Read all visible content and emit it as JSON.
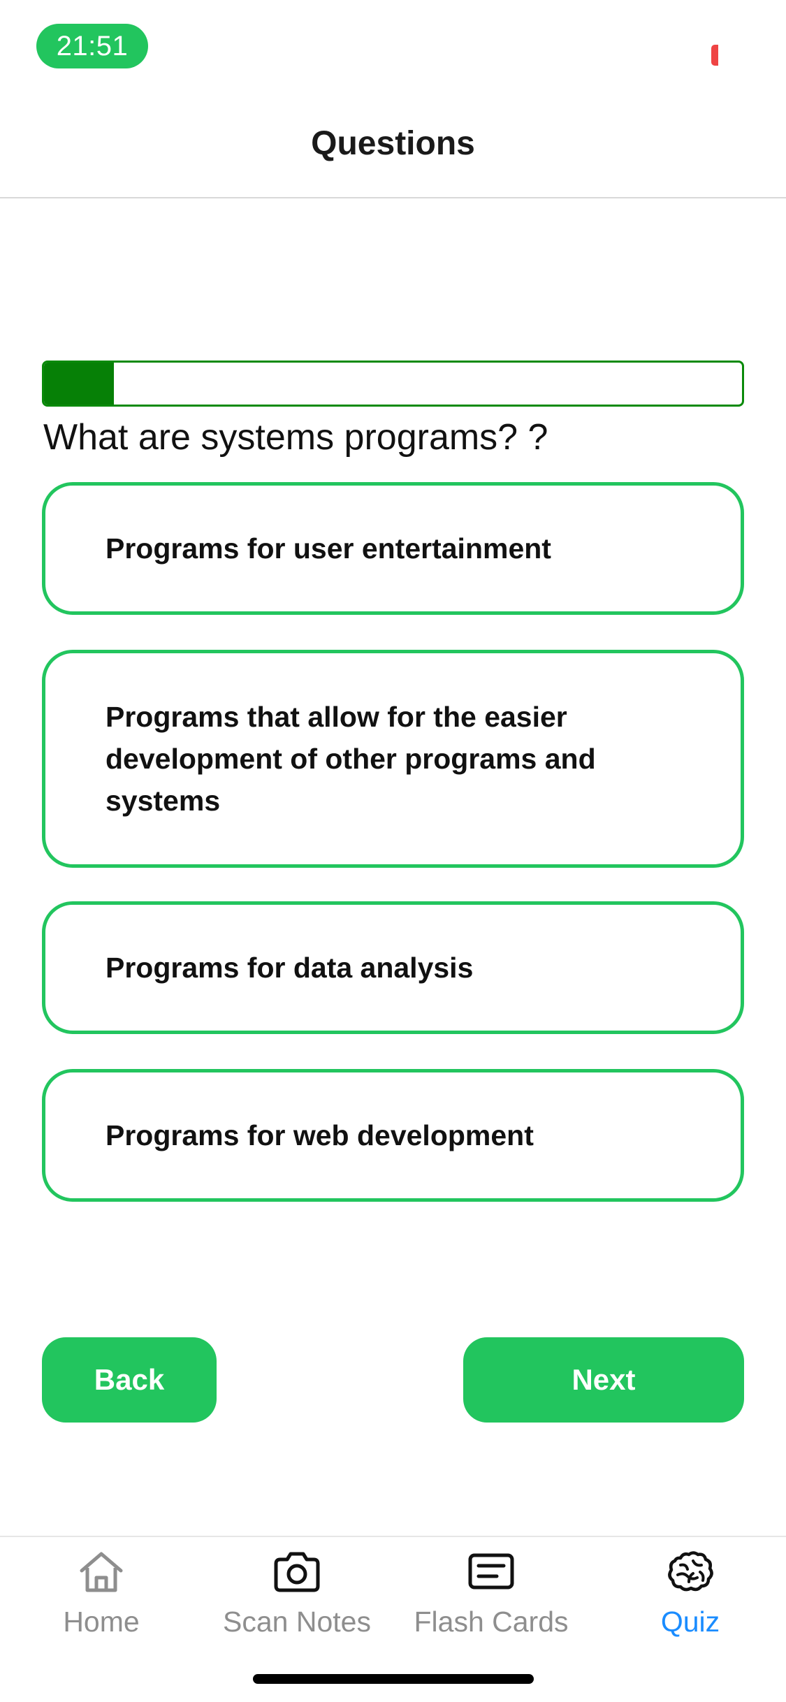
{
  "status_bar": {
    "time": "21:51"
  },
  "header": {
    "title": "Questions"
  },
  "quiz": {
    "progress_fraction": 0.1,
    "question": "What are systems programs? ?",
    "answers": [
      "Programs for user entertainment",
      "Programs that allow for the easier development of other programs and systems",
      "Programs for data analysis",
      "Programs for web development"
    ]
  },
  "nav_buttons": {
    "back_label": "Back",
    "next_label": "Next"
  },
  "tabbar": {
    "tabs": [
      {
        "label": "Home",
        "icon": "home-icon",
        "active": false
      },
      {
        "label": "Scan Notes",
        "icon": "camera-icon",
        "active": false
      },
      {
        "label": "Flash Cards",
        "icon": "flashcard-icon",
        "active": false
      },
      {
        "label": "Quiz",
        "icon": "brain-icon",
        "active": true
      }
    ]
  },
  "colors": {
    "accent": "#22c55e",
    "progress": "#068006",
    "active_tab": "#1a8cff",
    "inactive_tab": "#8e8e8e"
  }
}
